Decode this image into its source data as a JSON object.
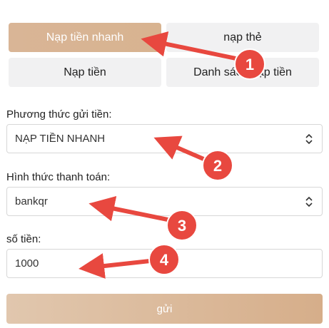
{
  "tabs": [
    {
      "label": "Nạp tiền nhanh",
      "active": true
    },
    {
      "label": "nạp thẻ",
      "active": false
    },
    {
      "label": "Nạp tiền",
      "active": false
    },
    {
      "label": "Danh sách nạp tiền",
      "active": false
    }
  ],
  "form": {
    "method_label": "Phương thức gửi tiền:",
    "method_value": "NẠP TIỀN NHANH",
    "payment_label": "Hình thức thanh toán:",
    "payment_value": "bankqr",
    "amount_label": "số tiền:",
    "amount_value": "1000",
    "submit_label": "gửi"
  },
  "annotations": [
    {
      "number": "1"
    },
    {
      "number": "2"
    },
    {
      "number": "3"
    },
    {
      "number": "4"
    }
  ],
  "colors": {
    "active_tab": "#d8b391",
    "tab_bg": "#f1f1f2",
    "arrow_red": "#e8483f",
    "submit": "#dcbb9c"
  },
  "icons": {
    "select_chevron": "chevron-up-down-icon"
  }
}
